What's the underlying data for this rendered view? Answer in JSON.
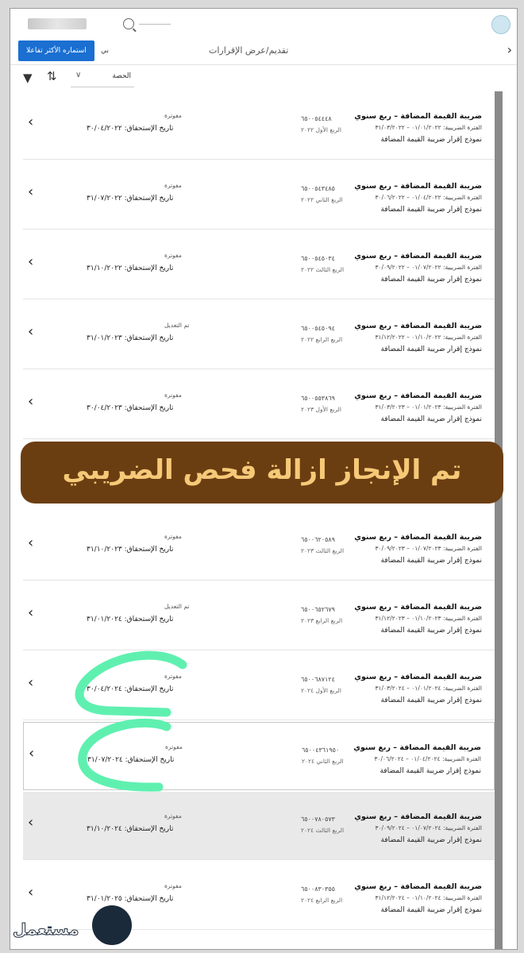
{
  "topbar": {
    "logo_icon": "logo-icon"
  },
  "header": {
    "button_label": "استماره الأكثر تفاعلا",
    "small_label": "بي",
    "title": "تقديم/عرض الإقرارات"
  },
  "toolbar": {
    "select_value": "الحصة"
  },
  "rows": [
    {
      "type": "ضريبة القيمة المضافة – ربع سنوي",
      "period": "الفترة الضريبية: ٠١/٠١/٢٠٢٢ – ٣١/٠٣/٢٠٢٢",
      "form": "نموذج إقرار ضريبة القيمة المضافة",
      "number": "٦٥٠٠٥٤٤٤٨",
      "quarter": "الربع الأول ٢٠٢٢",
      "status": "مفوترة",
      "due": "تاريخ الإستحقاق: ٣٠/٠٤/٢٠٢٢"
    },
    {
      "type": "ضريبة القيمة المضافة – ربع سنوي",
      "period": "الفترة الضريبية: ٠١/٠٤/٢٠٢٢ – ٣٠/٠٦/٢٠٢٢",
      "form": "نموذج إقرار ضريبة القيمة المضافة",
      "number": "٦٥٠٠٥٤٣٤٨٥",
      "quarter": "الربع الثاني ٢٠٢٢",
      "status": "مفوترة",
      "due": "تاريخ الإستحقاق: ٣١/٠٧/٢٠٢٢"
    },
    {
      "type": "ضريبة القيمة المضافة – ربع سنوي",
      "period": "الفترة الضريبية: ٠١/٠٧/٢٠٢٢ – ٣٠/٠٩/٢٠٢٢",
      "form": "نموذج إقرار ضريبة القيمة المضافة",
      "number": "٦٥٠٠٥٤٥٠٣٤",
      "quarter": "الربع الثالث ٢٠٢٢",
      "status": "مفوترة",
      "due": "تاريخ الإستحقاق: ٣١/١٠/٢٠٢٢"
    },
    {
      "type": "ضريبة القيمة المضافة – ربع سنوي",
      "period": "الفترة الضريبية: ٠١/١٠/٢٠٢٢ – ٣١/١٢/٢٠٢٢",
      "form": "نموذج إقرار ضريبة القيمة المضافة",
      "number": "٦٥٠٠٥٤٥٠٩٤",
      "quarter": "الربع الرابع ٢٠٢٢",
      "status": "تم التعديل",
      "due": "تاريخ الإستحقاق: ٣١/٠١/٢٠٢٣"
    },
    {
      "type": "ضريبة القيمة المضافة – ربع سنوي",
      "period": "الفترة الضريبية: ٠١/٠١/٢٠٢٣ – ٣١/٠٣/٢٠٢٣",
      "form": "نموذج إقرار ضريبة القيمة المضافة",
      "number": "٦٥٠٠٥٥٣٨٦٩",
      "quarter": "الربع الأول ٢٠٢٣",
      "status": "مفوترة",
      "due": "تاريخ الإستحقاق: ٣٠/٠٤/٢٠٢٣"
    },
    {
      "type": "ضريبة القيمة المضافة – ربع سنوي",
      "period": "الفترة الضريبية: ٠١/٠٧/٢٠٢٣ – ٣٠/٠٩/٢٠٢٣",
      "form": "نموذج إقرار ضريبة القيمة المضافة",
      "number": "٦٥٠٠٦٢٠٥٨٩",
      "quarter": "الربع الثالث ٢٠٢٣",
      "status": "مفوترة",
      "due": "تاريخ الإستحقاق: ٣١/١٠/٢٠٢٣"
    },
    {
      "type": "ضريبة القيمة المضافة – ربع سنوي",
      "period": "الفترة الضريبية: ٠١/١٠/٢٠٢٣ – ٣١/١٢/٢٠٢٣",
      "form": "نموذج إقرار ضريبة القيمة المضافة",
      "number": "٦٥٠٠٦٥٢٦٧٩",
      "quarter": "الربع الرابع ٢٠٢٣",
      "status": "تم التعديل",
      "due": "تاريخ الإستحقاق: ٣١/٠١/٢٠٢٤"
    },
    {
      "type": "ضريبة القيمة المضافة – ربع سنوي",
      "period": "الفترة الضريبية: ٠١/٠١/٢٠٢٤ – ٣١/٠٣/٢٠٢٤",
      "form": "نموذج إقرار ضريبة القيمة المضافة",
      "number": "٦٥٠٠٦٨٧١٢٤",
      "quarter": "الربع الأول ٢٠٢٤",
      "status": "مفوترة",
      "due": "تاريخ الإستحقاق: ٣٠/٠٤/٢٠٢٤"
    },
    {
      "type": "ضريبة القيمة المضافة – ربع سنوي",
      "period": "الفترة الضريبية: ٠١/٠٤/٢٠٢٤ – ٣٠/٠٦/٢٠٢٤",
      "form": "نموذج إقرار ضريبة القيمة المضافة",
      "number": "٦٥٠٠٤٣٦١٩٥٠",
      "quarter": "الربع الثاني ٢٠٢٤",
      "status": "مفوترة",
      "due": "تاريخ الإستحقاق: ٣١/٠٧/٢٠٢٤"
    },
    {
      "type": "ضريبة القيمة المضافة – ربع سنوي",
      "period": "الفترة الضريبية: ٠١/٠٧/٢٠٢٤ – ٣٠/٠٩/٢٠٢٤",
      "form": "نموذج إقرار ضريبة القيمة المضافة",
      "number": "٦٥٠٠٧٨٠٥٧٣",
      "quarter": "الربع الثالث ٢٠٢٤",
      "status": "مفوترة",
      "due": "تاريخ الإستحقاق: ٣١/١٠/٢٠٢٤"
    },
    {
      "type": "ضريبة القيمة المضافة – ربع سنوي",
      "period": "الفترة الضريبية: ٠١/١٠/٢٠٢٤ – ٣١/١٢/٢٠٢٤",
      "form": "نموذج إقرار ضريبة القيمة المضافة",
      "number": "٦٥٠٠٨٣٠٣٥٥",
      "quarter": "الربع الرابع ٢٠٢٤",
      "status": "مفوترة",
      "due": "تاريخ الإستحقاق: ٣١/٠١/٢٠٢٥"
    }
  ],
  "banner": {
    "text": "تم الإنجاز ازالة فحص الضريبي"
  },
  "watermark": {
    "text": "مستعمل"
  },
  "colors": {
    "accent": "#1a6fd1",
    "banner_bg": "#6b3e12",
    "banner_text": "#f6c978",
    "highlight_mark": "#5ff0b0"
  }
}
